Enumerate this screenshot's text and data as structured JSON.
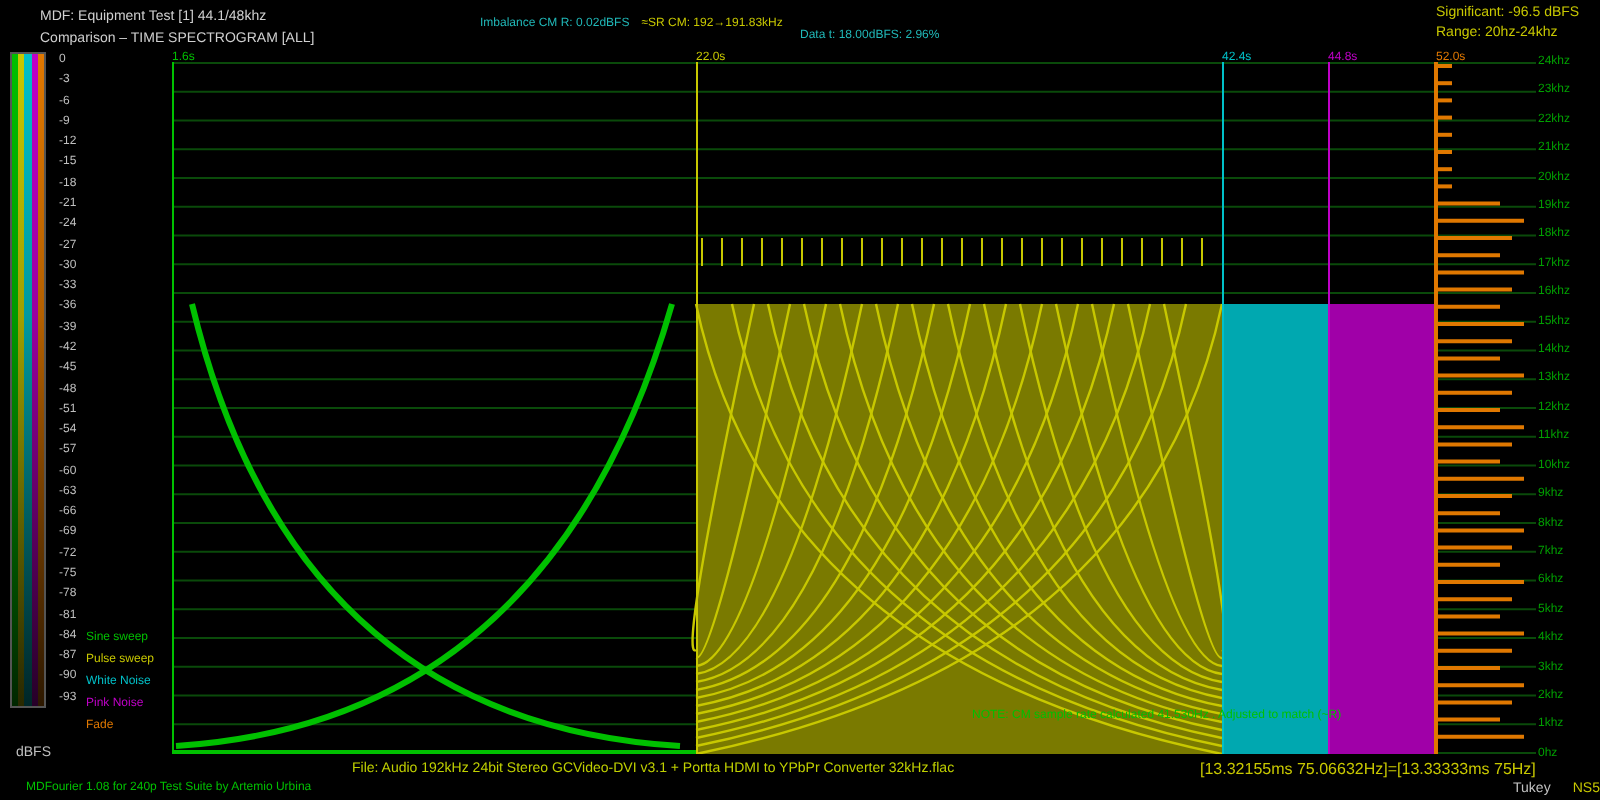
{
  "header": {
    "title": "MDF: Equipment Test [1] 44.1/48khz",
    "subtitle": "Comparison – TIME SPECTROGRAM [ALL]",
    "imbalance": "Imbalance CM R: 0.02dBFS",
    "sample_rate": "≈SR CM: 192→191.83kHz",
    "data": "Data t: 18.00dBFS: 2.96%",
    "significant": "Significant: -96.5 dBFS",
    "range": "Range: 20hz-24khz"
  },
  "colorbar": {
    "ticks": [
      "0",
      "-3",
      "-6",
      "-9",
      "-12",
      "-15",
      "-18",
      "-21",
      "-24",
      "-27",
      "-30",
      "-33",
      "-36",
      "-39",
      "-42",
      "-45",
      "-48",
      "-51",
      "-54",
      "-57",
      "-60",
      "-63",
      "-66",
      "-69",
      "-72",
      "-75",
      "-78",
      "-81",
      "-84",
      "-87",
      "-90",
      "-93"
    ],
    "unit": "dBFS"
  },
  "legend": [
    {
      "label": "Sine sweep",
      "color": "#00c000"
    },
    {
      "label": "Pulse sweep",
      "color": "#c8c800"
    },
    {
      "label": "White Noise",
      "color": "#00c0c8"
    },
    {
      "label": "Pink Noise",
      "color": "#c000c8"
    },
    {
      "label": "Fade",
      "color": "#e07800"
    }
  ],
  "time_markers": [
    {
      "label": "1.6s",
      "color": "#00c000"
    },
    {
      "label": "22.0s",
      "color": "#c8c800"
    },
    {
      "label": "42.4s",
      "color": "#00c0c8"
    },
    {
      "label": "44.8s",
      "color": "#c000c8"
    },
    {
      "label": "52.0s",
      "color": "#e07800"
    }
  ],
  "frequency_labels": [
    "24khz",
    "23khz",
    "22khz",
    "21khz",
    "20khz",
    "19khz",
    "18khz",
    "17khz",
    "16khz",
    "15khz",
    "14khz",
    "13khz",
    "12khz",
    "11khz",
    "10khz",
    "9khz",
    "8khz",
    "7khz",
    "6khz",
    "5khz",
    "4khz",
    "3khz",
    "2khz",
    "1khz",
    "0hz"
  ],
  "note": "NOTE: CM sample rate calculated 41.530Hz . Adjusted to match (~R)",
  "footer": {
    "file": "File: Audio  192kHz 24bit Stereo GCVideo-DVI v3.1 + Portta HDMI to YPbPr Converter 32kHz.flac",
    "period": "[13.32155ms 75.06632Hz]=[13.33333ms 75Hz]",
    "credit": "MDFourier 1.08 for 240p Test Suite by Artemio Urbina",
    "window": "Tukey",
    "extra": "NS5"
  }
}
